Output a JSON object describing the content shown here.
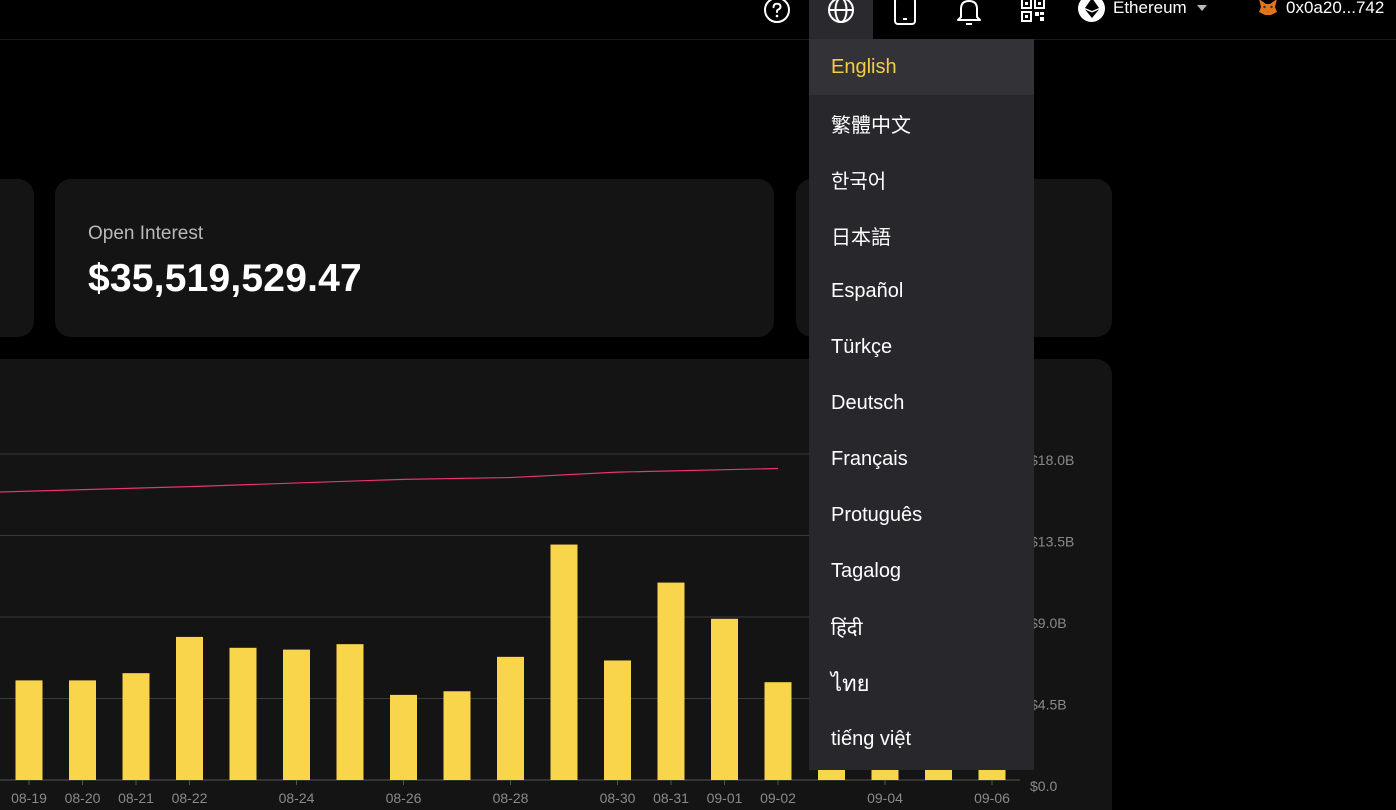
{
  "topbar": {
    "network_label": "Ethereum",
    "wallet_address": "0x0a20...742",
    "icons": [
      "help-icon",
      "globe-icon",
      "mobile-icon",
      "bell-icon",
      "qr-code-icon",
      "ethereum-icon",
      "metamask-fox-icon"
    ]
  },
  "open_interest": {
    "label": "Open Interest",
    "value": "$35,519,529.47"
  },
  "language_menu": {
    "selected": "English",
    "items": [
      "English",
      "繁體中文",
      "한국어",
      "日本語",
      "Español",
      "Türkçe",
      "Deutsch",
      "Français",
      "Protuguês",
      "Tagalog",
      "हिंदी",
      "ไทย",
      "tiếng việt"
    ]
  },
  "colors": {
    "accent_yellow": "#f5cc45",
    "bar_yellow": "#f8d54b",
    "line_pink": "#e8356a",
    "card_bg": "#141414",
    "menu_bg": "#27272c"
  },
  "chart_data": {
    "type": "bar",
    "x_labels": [
      "08-19",
      "08-20",
      "08-21",
      "08-22",
      "08-24",
      "08-26",
      "08-28",
      "08-30",
      "08-31",
      "09-01",
      "09-02",
      "09-04",
      "09-06"
    ],
    "y_right_ticks": [
      "$0.0",
      "$4.5B",
      "$9.0B",
      "$13.5B",
      "$18.0B"
    ],
    "ylim": [
      0,
      18
    ],
    "y_unit": "B",
    "grid": true,
    "bars": [
      {
        "x": "08-19",
        "value": 5.5
      },
      {
        "x": "08-20",
        "value": 5.5
      },
      {
        "x": "08-21",
        "value": 5.9
      },
      {
        "x": "08-22",
        "value": 7.9
      },
      {
        "x": "08-23",
        "value": 7.3
      },
      {
        "x": "08-24",
        "value": 7.2
      },
      {
        "x": "08-25",
        "value": 7.5
      },
      {
        "x": "08-26",
        "value": 4.7
      },
      {
        "x": "08-27",
        "value": 4.9
      },
      {
        "x": "08-28",
        "value": 6.8
      },
      {
        "x": "08-29",
        "value": 13.0
      },
      {
        "x": "08-30",
        "value": 6.6
      },
      {
        "x": "08-31",
        "value": 10.9
      },
      {
        "x": "09-01",
        "value": 8.9
      },
      {
        "x": "09-02",
        "value": 5.4
      },
      {
        "x": "09-03",
        "value": 0.6
      },
      {
        "x": "09-04",
        "value": 0.6
      },
      {
        "x": "09-05",
        "value": 0.6
      },
      {
        "x": "09-06",
        "value": 0.6
      }
    ],
    "line": [
      {
        "x": "08-19",
        "value": 15.9
      },
      {
        "x": "08-22",
        "value": 16.2
      },
      {
        "x": "08-26",
        "value": 16.6
      },
      {
        "x": "08-28",
        "value": 16.7
      },
      {
        "x": "08-30",
        "value": 17.0
      },
      {
        "x": "09-02",
        "value": 17.2
      }
    ]
  }
}
